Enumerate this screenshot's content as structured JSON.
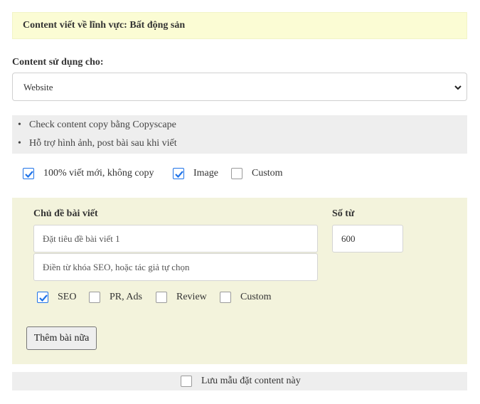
{
  "header": {
    "title": "Content viết về lĩnh vực: Bất động sản"
  },
  "usage": {
    "label": "Content sử dụng cho:",
    "selected": "Website"
  },
  "features": [
    "Check content copy bằng Copyscape",
    "Hỗ trợ hình ảnh, post bài sau khi viết"
  ],
  "options": [
    {
      "label": "100% viết mới, không copy",
      "checked": true
    },
    {
      "label": "Image",
      "checked": true
    },
    {
      "label": "Custom",
      "checked": false
    }
  ],
  "article": {
    "topic_label": "Chủ đề bài viết",
    "word_count_label": "Số từ",
    "title_placeholder": "Đặt tiêu đề bài viết 1",
    "keyword_placeholder": "Điền từ khóa SEO, hoặc tác giả tự chọn",
    "word_count_value": "600",
    "types": [
      {
        "label": "SEO",
        "checked": true
      },
      {
        "label": "PR, Ads",
        "checked": false
      },
      {
        "label": "Review",
        "checked": false
      },
      {
        "label": "Custom",
        "checked": false
      }
    ],
    "add_button": "Thêm bài nữa"
  },
  "save": {
    "label": "Lưu mẫu đặt content này",
    "checked": false
  },
  "colors": {
    "accent": "#1f73e8",
    "banner_bg": "#fbfcd4",
    "topic_bg": "#f3f3dc",
    "panel_bg": "#eeeeee"
  }
}
